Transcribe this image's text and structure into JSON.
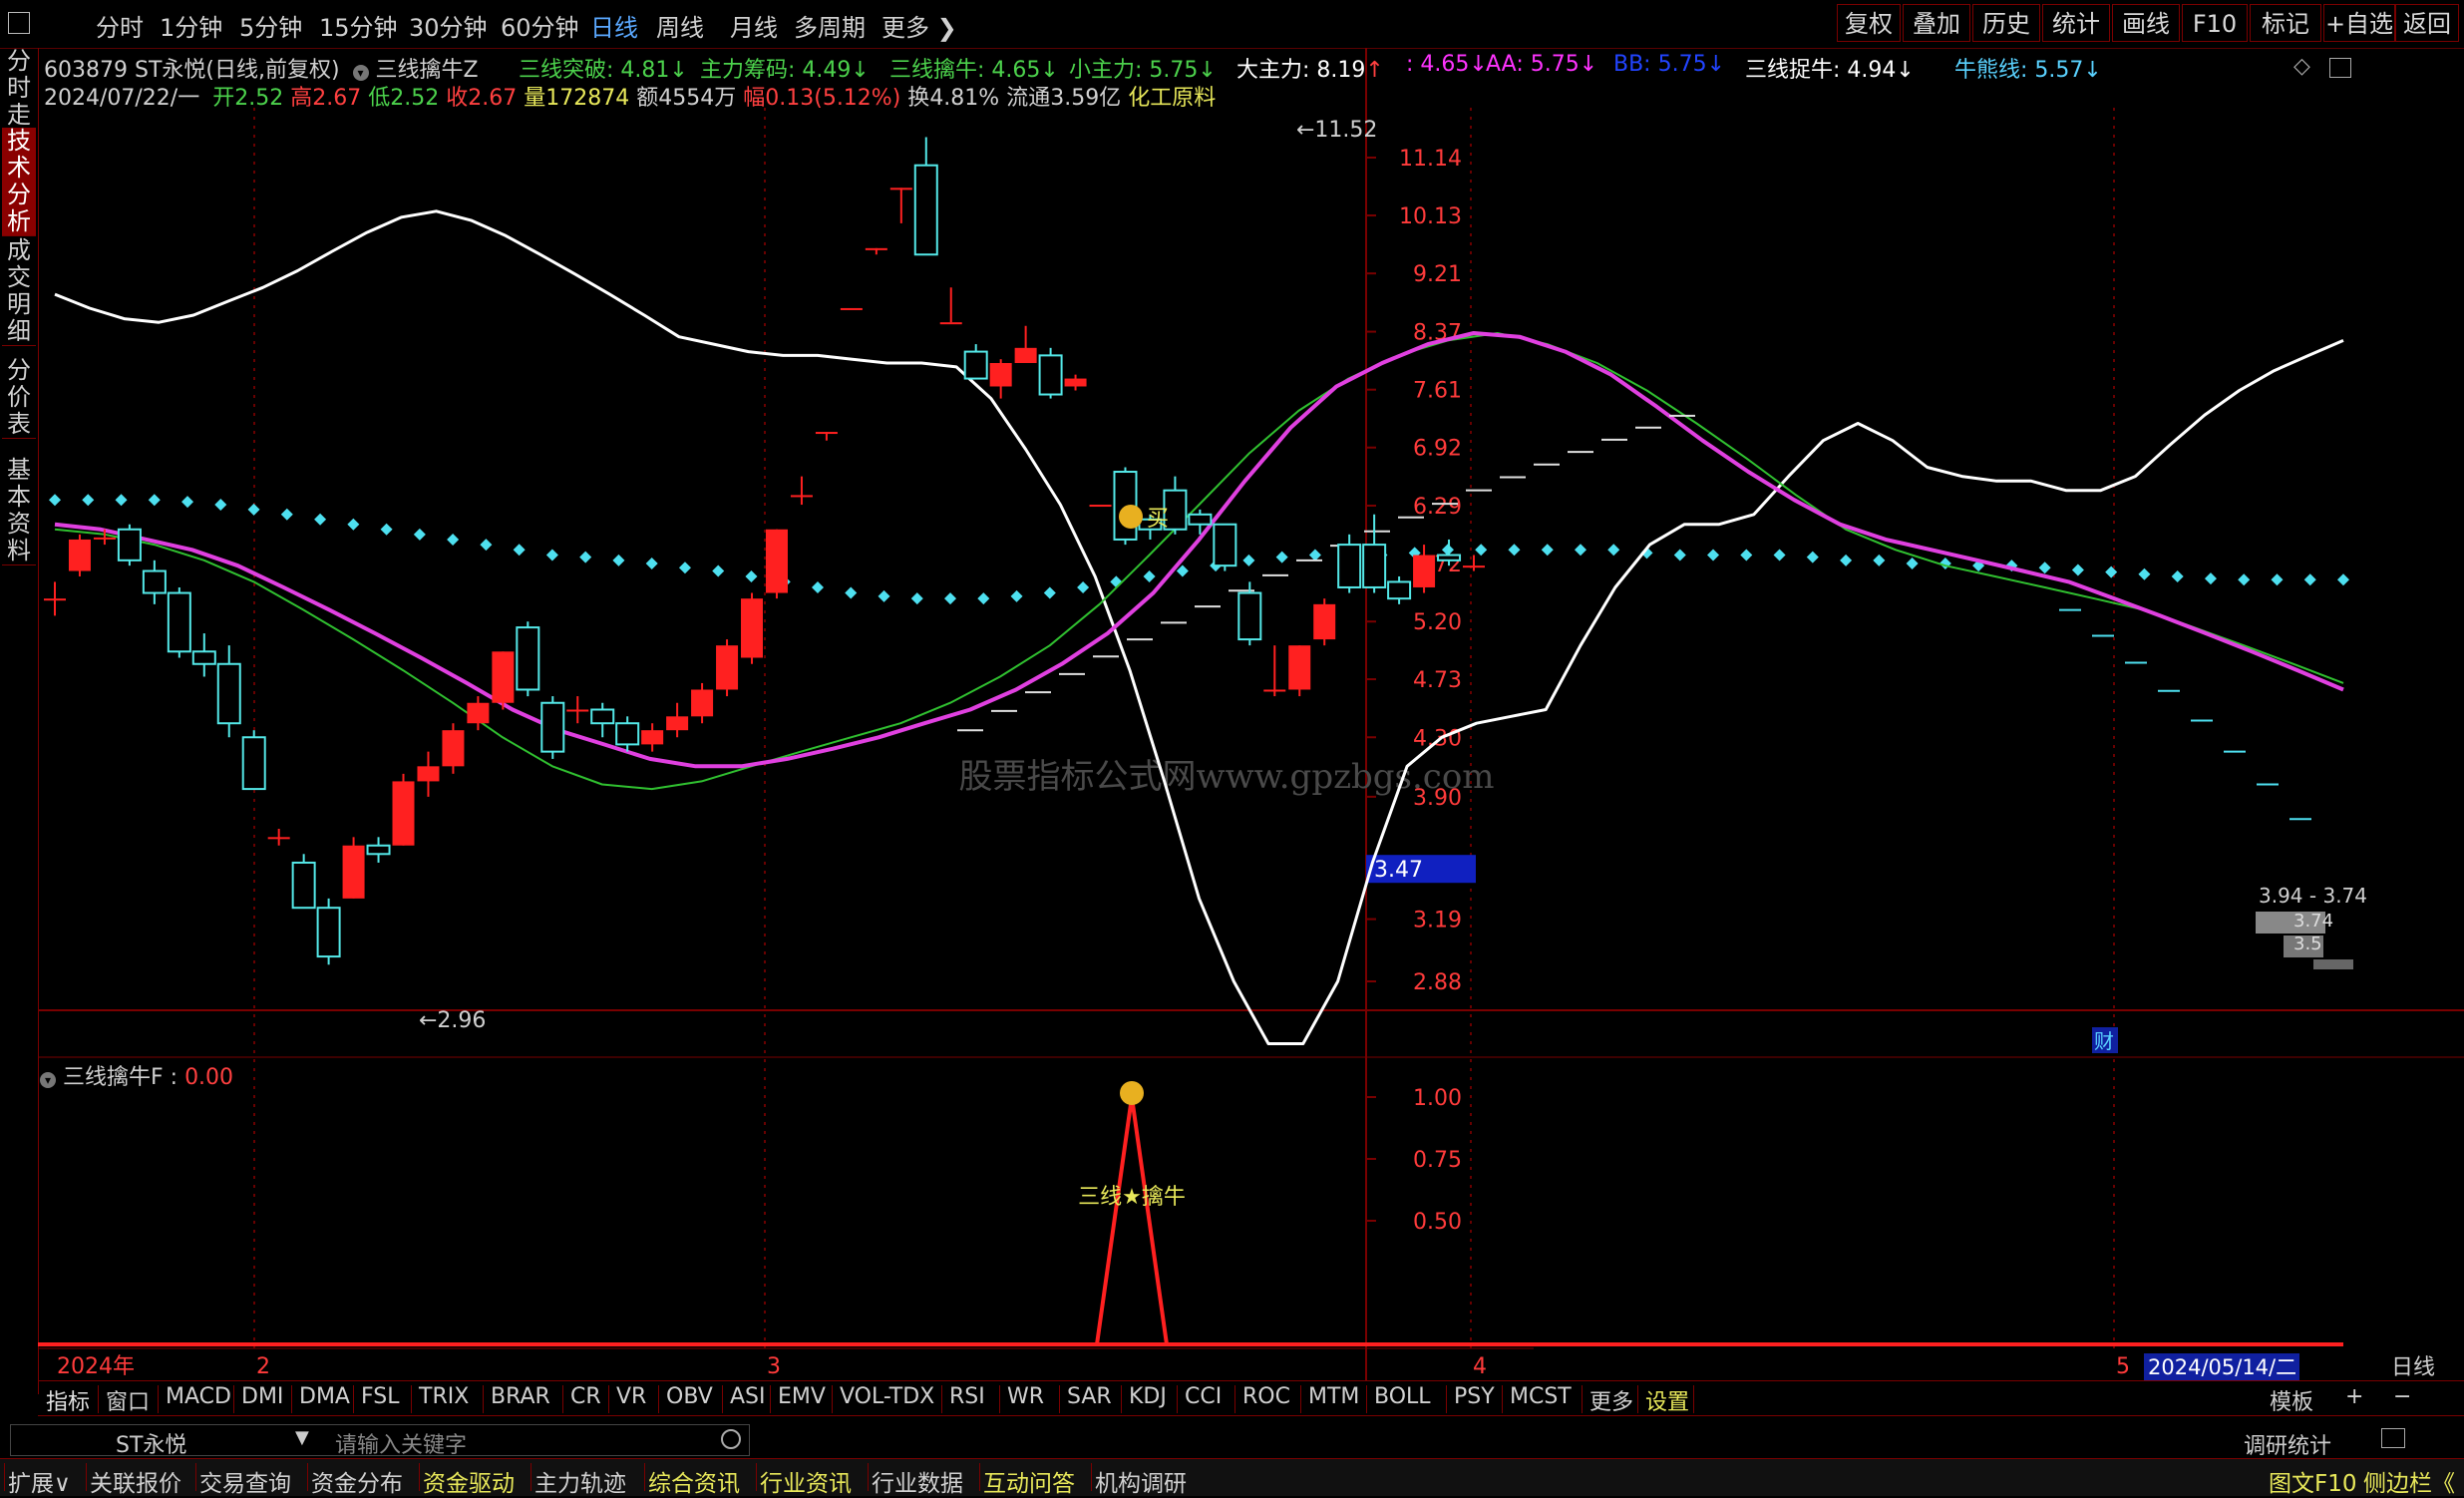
{
  "topbar": {
    "periods": [
      "分时",
      "1分钟",
      "5分钟",
      "15分钟",
      "30分钟",
      "60分钟",
      "日线",
      "周线",
      "月线",
      "多周期",
      "更多"
    ],
    "active_period": "日线",
    "right_buttons": [
      "复权",
      "叠加",
      "历史",
      "统计",
      "画线",
      "F10",
      "标记",
      "+自选",
      "返回"
    ]
  },
  "sidebar_tabs": [
    "分时走势",
    "技术分析",
    "成交明细",
    "分价表",
    "基本资料"
  ],
  "stock": {
    "code_name": "603879 ST永悦(日线,前复权)",
    "formula": "三线擒牛Z",
    "date": "2024/07/22/一",
    "open_label": "开",
    "open": "2.52",
    "high_label": "高",
    "high": "2.67",
    "low_label": "低",
    "low": "2.52",
    "close_label": "收",
    "close": "2.67",
    "volume_label": "量",
    "volume": "172874",
    "amount_label": "额",
    "amount": "4554万",
    "change_label": "幅",
    "change": "0.13(5.12%)",
    "turnover_label": "换",
    "turnover": "4.81%",
    "float_label": "流通",
    "float": "3.59亿",
    "industry": "化工原料"
  },
  "indicators": [
    {
      "label": "三线突破:",
      "value": "4.81",
      "arrow": "↓",
      "color": "#4cd24c"
    },
    {
      "label": "主力筹码:",
      "value": "4.49",
      "arrow": "↓",
      "color": "#4cd24c"
    },
    {
      "label": "三线擒牛:",
      "value": "4.65",
      "arrow": "↓",
      "color": "#4cd24c"
    },
    {
      "label": "小主力:",
      "value": "5.75",
      "arrow": "↓",
      "color": "#4cd24c"
    },
    {
      "label": "大主力:",
      "value": "8.19",
      "arrow": "↑",
      "color": "#ffffff"
    },
    {
      "label": ":",
      "value": "4.65",
      "arrow": "↓",
      "color": "#ff33ff"
    },
    {
      "label": "AA:",
      "value": "5.75",
      "arrow": "↓",
      "color": "#ff33ff"
    },
    {
      "label": "BB:",
      "value": "5.75",
      "arrow": "↓",
      "color": "#2244ff"
    },
    {
      "label": "三线捉牛:",
      "value": "4.94",
      "arrow": "↓",
      "color": "#ffffff"
    },
    {
      "label": "牛熊线:",
      "value": "5.57",
      "arrow": "↓",
      "color": "#5ad2ff"
    }
  ],
  "colors": {
    "up": "#ff2020",
    "down": "#54e8e8",
    "ma_magenta": "#e040e0",
    "ma_green": "#30c030",
    "white_line": "#ffffff",
    "grid": "#7a0000"
  },
  "price_axis": [
    "11.14",
    "10.13",
    "9.21",
    "8.37",
    "7.61",
    "6.92",
    "6.29",
    "5.72",
    "5.20",
    "4.73",
    "4.30",
    "3.90",
    "3.19",
    "2.88"
  ],
  "price_ticks": [
    11.14,
    10.13,
    9.21,
    8.37,
    7.61,
    6.92,
    6.29,
    5.72,
    5.2,
    4.73,
    4.3,
    3.9,
    3.19,
    2.88
  ],
  "current_price": "3.47",
  "markers": {
    "high": "11.52",
    "low": "2.96",
    "buy": "买",
    "right_labels": [
      "3.94 - 3.74",
      "3.74",
      "3.5"
    ],
    "fin": "财"
  },
  "watermark": "股票指标公式网www.gpzbgs.com",
  "chart_data": {
    "type": "candlestick",
    "candles": [
      {
        "o": 5.4,
        "c": 5.4,
        "h": 5.55,
        "l": 5.25
      },
      {
        "o": 5.65,
        "c": 5.95,
        "h": 6.0,
        "l": 5.6
      },
      {
        "o": 5.97,
        "c": 5.97,
        "h": 6.05,
        "l": 5.9
      },
      {
        "o": 6.05,
        "c": 5.75,
        "h": 6.1,
        "l": 5.7
      },
      {
        "o": 5.65,
        "c": 5.45,
        "h": 5.75,
        "l": 5.35
      },
      {
        "o": 5.45,
        "c": 4.95,
        "h": 5.5,
        "l": 4.9
      },
      {
        "o": 4.95,
        "c": 4.85,
        "h": 5.1,
        "l": 4.75
      },
      {
        "o": 4.85,
        "c": 4.4,
        "h": 5.0,
        "l": 4.3
      },
      {
        "o": 4.3,
        "c": 3.95,
        "h": 4.35,
        "l": 3.95
      },
      {
        "o": 3.65,
        "c": 3.65,
        "h": 3.7,
        "l": 3.6
      },
      {
        "o": 3.5,
        "c": 3.25,
        "h": 3.55,
        "l": 3.25
      },
      {
        "o": 3.25,
        "c": 3.0,
        "h": 3.3,
        "l": 2.96
      },
      {
        "o": 3.3,
        "c": 3.6,
        "h": 3.65,
        "l": 3.3
      },
      {
        "o": 3.6,
        "c": 3.55,
        "h": 3.65,
        "l": 3.5
      },
      {
        "o": 3.6,
        "c": 4.0,
        "h": 4.05,
        "l": 3.6
      },
      {
        "o": 4.0,
        "c": 4.1,
        "h": 4.2,
        "l": 3.9
      },
      {
        "o": 4.1,
        "c": 4.35,
        "h": 4.4,
        "l": 4.05
      },
      {
        "o": 4.4,
        "c": 4.55,
        "h": 4.6,
        "l": 4.35
      },
      {
        "o": 4.55,
        "c": 4.95,
        "h": 4.95,
        "l": 4.5
      },
      {
        "o": 5.15,
        "c": 4.65,
        "h": 5.2,
        "l": 4.6
      },
      {
        "o": 4.55,
        "c": 4.2,
        "h": 4.6,
        "l": 4.15
      },
      {
        "o": 4.5,
        "c": 4.5,
        "h": 4.6,
        "l": 4.4
      },
      {
        "o": 4.5,
        "c": 4.4,
        "h": 4.55,
        "l": 4.3
      },
      {
        "o": 4.4,
        "c": 4.25,
        "h": 4.45,
        "l": 4.2
      },
      {
        "o": 4.25,
        "c": 4.35,
        "h": 4.4,
        "l": 4.2
      },
      {
        "o": 4.35,
        "c": 4.45,
        "h": 4.55,
        "l": 4.3
      },
      {
        "o": 4.45,
        "c": 4.65,
        "h": 4.7,
        "l": 4.4
      },
      {
        "o": 4.65,
        "c": 5.0,
        "h": 5.05,
        "l": 4.6
      },
      {
        "o": 4.9,
        "c": 5.4,
        "h": 5.45,
        "l": 4.85
      },
      {
        "o": 5.45,
        "c": 6.05,
        "h": 6.05,
        "l": 5.4
      },
      {
        "o": 6.4,
        "c": 6.4,
        "h": 6.6,
        "l": 6.3
      },
      {
        "o": 7.1,
        "c": 7.1,
        "h": 7.1,
        "l": 7.0
      },
      {
        "o": 8.7,
        "c": 8.7,
        "h": 8.7,
        "l": 8.7
      },
      {
        "o": 9.6,
        "c": 9.6,
        "h": 9.6,
        "l": 9.5
      },
      {
        "o": 10.6,
        "c": 10.6,
        "h": 10.6,
        "l": 10.0
      },
      {
        "o": 11.0,
        "c": 9.5,
        "h": 11.52,
        "l": 9.5
      },
      {
        "o": 8.5,
        "c": 8.5,
        "h": 9.0,
        "l": 8.5
      },
      {
        "o": 8.1,
        "c": 7.75,
        "h": 8.2,
        "l": 7.75
      },
      {
        "o": 7.65,
        "c": 7.95,
        "h": 8.0,
        "l": 7.5
      },
      {
        "o": 7.95,
        "c": 8.15,
        "h": 8.45,
        "l": 7.95
      },
      {
        "o": 8.05,
        "c": 7.55,
        "h": 8.15,
        "l": 7.5
      },
      {
        "o": 7.65,
        "c": 7.75,
        "h": 7.8,
        "l": 7.6
      },
      {
        "o": 6.3,
        "c": 6.3,
        "h": 6.3,
        "l": 6.3
      },
      {
        "o": 6.65,
        "c": 5.95,
        "h": 6.7,
        "l": 5.9
      },
      {
        "o": 6.15,
        "c": 6.05,
        "h": 6.2,
        "l": 5.95
      },
      {
        "o": 6.45,
        "c": 6.05,
        "h": 6.6,
        "l": 6.0
      },
      {
        "o": 6.2,
        "c": 6.1,
        "h": 6.25,
        "l": 6.0
      },
      {
        "o": 6.1,
        "c": 5.7,
        "h": 6.1,
        "l": 5.65
      },
      {
        "o": 5.45,
        "c": 5.05,
        "h": 5.55,
        "l": 5.0
      },
      {
        "o": 4.65,
        "c": 4.65,
        "h": 5.0,
        "l": 4.6
      },
      {
        "o": 4.65,
        "c": 5.0,
        "h": 5.0,
        "l": 4.6
      },
      {
        "o": 5.05,
        "c": 5.35,
        "h": 5.4,
        "l": 5.0
      },
      {
        "o": 5.9,
        "c": 5.5,
        "h": 6.0,
        "l": 5.45
      },
      {
        "o": 5.9,
        "c": 5.5,
        "h": 6.2,
        "l": 5.45
      },
      {
        "o": 5.55,
        "c": 5.4,
        "h": 5.6,
        "l": 5.35
      },
      {
        "o": 5.5,
        "c": 5.8,
        "h": 5.9,
        "l": 5.45
      },
      {
        "o": 5.8,
        "c": 5.75,
        "h": 5.95,
        "l": 5.7
      },
      {
        "o": 5.7,
        "c": 5.7,
        "h": 5.8,
        "l": 5.65
      }
    ],
    "white_line": [
      8.9,
      8.7,
      8.55,
      8.5,
      8.6,
      8.8,
      9.0,
      9.25,
      9.55,
      9.85,
      10.1,
      10.2,
      10.05,
      9.8,
      9.5,
      9.2,
      8.9,
      8.6,
      8.3,
      8.2,
      8.1,
      8.05,
      8.05,
      8.0,
      7.95,
      7.95,
      7.9,
      7.5,
      6.9,
      6.3,
      5.6,
      4.8,
      4.0,
      3.3,
      2.88,
      2.6,
      2.6,
      2.88,
      3.5,
      4.1,
      4.3,
      4.4,
      4.45,
      4.5,
      5.0,
      5.5,
      5.9,
      6.1,
      6.1,
      6.2,
      6.6,
      7.0,
      7.2,
      7.0,
      6.7,
      6.6,
      6.55,
      6.55,
      6.45,
      6.45,
      6.6,
      6.95,
      7.3,
      7.6,
      7.85,
      8.05,
      8.25
    ],
    "magenta_line": [
      6.1,
      6.05,
      5.95,
      5.85,
      5.7,
      5.5,
      5.3,
      5.1,
      4.9,
      4.7,
      4.5,
      4.35,
      4.25,
      4.15,
      4.1,
      4.1,
      4.15,
      4.22,
      4.3,
      4.4,
      4.5,
      4.65,
      4.85,
      5.1,
      5.45,
      5.95,
      6.55,
      7.15,
      7.65,
      7.95,
      8.2,
      8.35,
      8.3,
      8.1,
      7.8,
      7.4,
      7.0,
      6.65,
      6.35,
      6.1,
      5.95,
      5.85,
      5.75,
      5.65,
      5.55,
      5.4,
      5.25,
      5.1,
      4.95,
      4.8,
      4.65
    ],
    "green_line": [
      6.05,
      6.0,
      5.9,
      5.75,
      5.55,
      5.3,
      5.05,
      4.8,
      4.55,
      4.3,
      4.1,
      3.98,
      3.95,
      4.0,
      4.1,
      4.2,
      4.3,
      4.4,
      4.55,
      4.75,
      5.0,
      5.35,
      5.8,
      6.3,
      6.85,
      7.35,
      7.75,
      8.05,
      8.25,
      8.35,
      8.2,
      7.95,
      7.6,
      7.2,
      6.8,
      6.4,
      6.05,
      5.85,
      5.7,
      5.6,
      5.5,
      5.4,
      5.3,
      5.15,
      5.0,
      4.85,
      4.7
    ],
    "cyan_dots": [
      6.35,
      6.35,
      6.35,
      6.35,
      6.33,
      6.3,
      6.25,
      6.2,
      6.15,
      6.1,
      6.05,
      6.0,
      5.95,
      5.9,
      5.85,
      5.8,
      5.78,
      5.75,
      5.72,
      5.68,
      5.65,
      5.6,
      5.55,
      5.5,
      5.45,
      5.42,
      5.4,
      5.4,
      5.4,
      5.42,
      5.45,
      5.5,
      5.55,
      5.6,
      5.65,
      5.7,
      5.75,
      5.78,
      5.8,
      5.8,
      5.8,
      5.82,
      5.85,
      5.85,
      5.85,
      5.85,
      5.85,
      5.85,
      5.82,
      5.8,
      5.8,
      5.8,
      5.8,
      5.78,
      5.75,
      5.75,
      5.72,
      5.72,
      5.7,
      5.7,
      5.68,
      5.66,
      5.64,
      5.62,
      5.6,
      5.58,
      5.57,
      5.57,
      5.57,
      5.57
    ],
    "x_labels": [
      {
        "label": "2024年",
        "i": 0
      },
      {
        "label": "2",
        "i": 6
      },
      {
        "label": "3",
        "i": 21
      },
      {
        "label": "4",
        "i": 41
      },
      {
        "label": "5",
        "i": 60
      }
    ],
    "end_date": "2024/05/14/二"
  },
  "sub_indicator": {
    "title": "三线擒牛F",
    "value": "0.00",
    "axis": [
      "1.00",
      "0.75",
      "0.50"
    ],
    "axis_values": [
      1.0,
      0.75,
      0.5
    ],
    "signal_label": "三线★擒牛",
    "signal_series": [
      0,
      0,
      1,
      0,
      0
    ]
  },
  "period_label": "日线",
  "bottom_tabs": [
    "指标",
    "窗口",
    "MACD",
    "DMI",
    "DMA",
    "FSL",
    "TRIX",
    "BRAR",
    "CR",
    "VR",
    "OBV",
    "ASI",
    "EMV",
    "VOL-TDX",
    "RSI",
    "WR",
    "SAR",
    "KDJ",
    "CCI",
    "ROC",
    "MTM",
    "BOLL",
    "PSY",
    "MCST",
    "更多",
    "设置"
  ],
  "bottom_right": [
    "模板",
    "+",
    "−"
  ],
  "search": {
    "stock": "ST永悦",
    "placeholder": "请输入关键字",
    "right_label": "调研统计"
  },
  "footer": [
    "扩展∨",
    "关联报价",
    "交易查询",
    "资金分布",
    "资金驱动",
    "主力轨迹",
    "综合资讯",
    "行业资讯",
    "行业数据",
    "互动问答",
    "机构调研"
  ],
  "footer_right": [
    "图文F10",
    "侧边栏《"
  ]
}
